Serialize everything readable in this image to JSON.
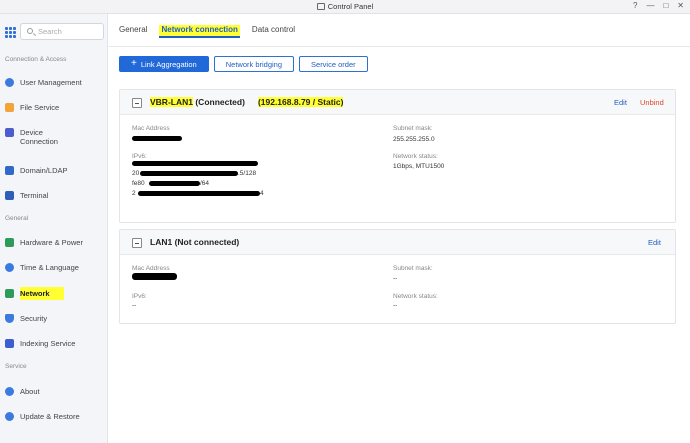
{
  "window": {
    "title": "Control Panel",
    "controls": {
      "help": "?",
      "minimize": "—",
      "maximize": "□",
      "close": "✕"
    }
  },
  "sidebar": {
    "search_placeholder": "Search",
    "sections": {
      "connection": "Connection & Access",
      "general": "General",
      "service": "Service"
    },
    "items": [
      {
        "label": "User Management",
        "icon": "user-management-icon",
        "color": "#3b7be0"
      },
      {
        "label": "File Service",
        "icon": "folder-icon",
        "color": "#f2a33a"
      },
      {
        "label": "Device\nConnection",
        "icon": "device-icon",
        "color": "#4b5dcf"
      },
      {
        "label": "Domain/LDAP",
        "icon": "domain-icon",
        "color": "#3169c9"
      },
      {
        "label": "Terminal",
        "icon": "terminal-icon",
        "color": "#2d5fb8"
      },
      {
        "label": "Hardware & Power",
        "icon": "hardware-icon",
        "color": "#2f9b5b"
      },
      {
        "label": "Time & Language",
        "icon": "clock-icon",
        "color": "#3b7be0"
      },
      {
        "label": "Network",
        "icon": "network-icon",
        "color": "#2f9b5b"
      },
      {
        "label": "Security",
        "icon": "shield-icon",
        "color": "#3b7be0"
      },
      {
        "label": "Indexing Service",
        "icon": "indexing-icon",
        "color": "#3b5fd0"
      },
      {
        "label": "About",
        "icon": "info-icon",
        "color": "#3b7be0"
      },
      {
        "label": "Update & Restore",
        "icon": "update-icon",
        "color": "#3b7be0"
      }
    ]
  },
  "tabs": [
    {
      "label": "General"
    },
    {
      "label": "Network connection"
    },
    {
      "label": "Data control"
    }
  ],
  "actions": {
    "link_aggregation": "Link Aggregation",
    "network_bridging": "Network bridging",
    "service_order": "Service order"
  },
  "cards": [
    {
      "name": "VBR-LAN1",
      "status": " (Connected)",
      "address": "(192.168.8.79 / Static)",
      "edit": "Edit",
      "unbind": "Unbind",
      "mac_label": "Mac Address",
      "ipv6_label": "IPv6:",
      "ipv6_lines": [
        "20",
        ".5/128",
        "fe80",
        "/64",
        "2",
        "4"
      ],
      "subnet_label": "Subnet mask:",
      "subnet_value": "255.255.255.0",
      "status_label": "Network status:",
      "status_value": "1Gbps,   MTU1500"
    },
    {
      "name": "LAN1",
      "status": " (Not connected)",
      "edit": "Edit",
      "mac_label": "Mac Address",
      "ipv6_label": "IPv6:",
      "ipv6_value": "--",
      "subnet_label": "Subnet mask:",
      "subnet_value": "--",
      "status_label": "Network status:",
      "status_value": "--"
    }
  ],
  "colors": {
    "accent": "#2168d9",
    "highlight": "#ffff33",
    "danger": "#e0462b"
  }
}
